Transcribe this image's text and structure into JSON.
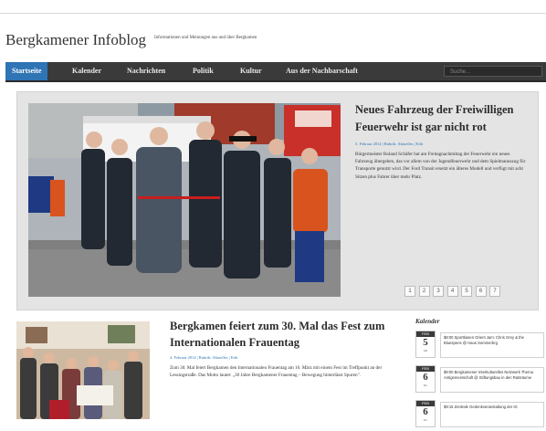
{
  "site": {
    "title": "Bergkamener Infoblog",
    "tagline": "Informationen und Meinungen aus und über Bergkamen"
  },
  "nav": {
    "items": [
      {
        "label": "Startseite",
        "active": true
      },
      {
        "label": "Kalender",
        "active": false
      },
      {
        "label": "Nachrichten",
        "active": false
      },
      {
        "label": "Politik",
        "active": false
      },
      {
        "label": "Kultur",
        "active": false
      },
      {
        "label": "Aus der Nachbarschaft",
        "active": false
      }
    ],
    "search_placeholder": "Suche..."
  },
  "featured": {
    "title": "Neues Fahrzeug der Freiwilligen Feuerwehr ist gar nicht rot",
    "meta": "5. Februar 2014 | Rubrik: Aktuelles | Edit",
    "body": "Bürgermeister Roland Schäfer hat am Freitagnachmittag der Feuerwehr ein neues Fahrzeug übergeben, das vor allem von der Jugendfeuerwehr und dem Spielmannszug für Transporte genutzt wird. Der Ford Transit ersetzt ein älteres Modell und verfügt mit acht Sitzen plus Fahrer über mehr Platz.",
    "pager": [
      "1",
      "2",
      "3",
      "4",
      "5",
      "6",
      "7"
    ]
  },
  "article": {
    "title": "Bergkamen feiert zum 30. Mal das Fest zum Internationalen Frauentag",
    "meta": "4. Februar 2014 | Rubrik: Aktuelles | Edit",
    "body": "Zum 30. Mal feiert Bergkamen den Internationalen Frauentag am 16. März mit einem Fest im Treffpunkt an der Lessingstraße. Das Motto lautet: „30 Jahre Bergkamener Frauentag – Bewegung hinterlässt Spuren\"."
  },
  "sidebar": {
    "title": "Kalender",
    "events": [
      {
        "month": "FEB",
        "day": "5",
        "weekday": "Mi",
        "text": "$8:00 Sportbasen Orient Jam: Chris Grey & the Bluespens @ Haus Sommerbrg"
      },
      {
        "month": "FEB",
        "day": "6",
        "weekday": "Do",
        "text": "$9:00 Bergkamener Interkulturelles Netzwerk Thema Antigemeinschaft @ Stiftungsbau in den Ratsräume"
      },
      {
        "month": "FEB",
        "day": "6",
        "weekday": "Do",
        "text": "$9:15 Zentrale Gedenkveranstaltung der IG"
      }
    ]
  },
  "colors": {
    "nav_bg": "#3a3a3a",
    "nav_active": "#2f74b5",
    "link": "#2f74b5",
    "featured_bg": "#e4e4e4"
  }
}
